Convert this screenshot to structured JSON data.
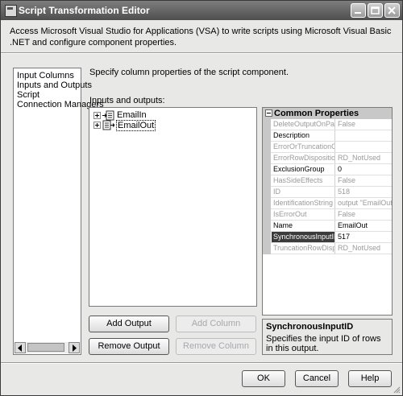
{
  "window": {
    "title": "Script Transformation Editor"
  },
  "header": {
    "description": "Access Microsoft Visual Studio for Applications (VSA) to write scripts using Microsoft Visual Basic .NET and configure component properties."
  },
  "sidebar": {
    "items": [
      "Input Columns",
      "Inputs and Outputs",
      "Script",
      "Connection Managers"
    ]
  },
  "main": {
    "subtitle": "Specify column properties of the script component.",
    "io_label": "Inputs and outputs:",
    "tree": [
      {
        "label": "EmailIn",
        "icon": "input-icon"
      },
      {
        "label": "EmailOut",
        "icon": "output-icon",
        "selected": true
      }
    ],
    "buttons": {
      "add_output": "Add Output",
      "add_column": "Add Column",
      "remove_output": "Remove Output",
      "remove_column": "Remove Column"
    }
  },
  "properties": {
    "category": "Common Properties",
    "rows": [
      {
        "name": "DeleteOutputOnPath",
        "value": "False",
        "state": "disabled"
      },
      {
        "name": "Description",
        "value": "",
        "state": "enabled"
      },
      {
        "name": "ErrorOrTruncationOp",
        "value": "",
        "state": "disabled"
      },
      {
        "name": "ErrorRowDisposition",
        "value": "RD_NotUsed",
        "state": "disabled"
      },
      {
        "name": "ExclusionGroup",
        "value": "0",
        "state": "enabled"
      },
      {
        "name": "HasSideEffects",
        "value": "False",
        "state": "disabled"
      },
      {
        "name": "ID",
        "value": "518",
        "state": "disabled"
      },
      {
        "name": "IdentificationString",
        "value": "output \"EmailOut\"",
        "state": "disabled"
      },
      {
        "name": "IsErrorOut",
        "value": "False",
        "state": "disabled"
      },
      {
        "name": "Name",
        "value": "EmailOut",
        "state": "enabled"
      },
      {
        "name": "SynchronousInputID",
        "value": "517",
        "state": "selected"
      },
      {
        "name": "TruncationRowDispos",
        "value": "RD_NotUsed",
        "state": "disabled"
      }
    ],
    "help": {
      "title": "SynchronousInputID",
      "description": "Specifies the input ID of rows in this output."
    }
  },
  "footer": {
    "ok": "OK",
    "cancel": "Cancel",
    "help": "Help"
  },
  "colors": {
    "titlebar": "#5a5a5a",
    "selection": "#3b3b3b",
    "category": "#c8c8c8"
  }
}
